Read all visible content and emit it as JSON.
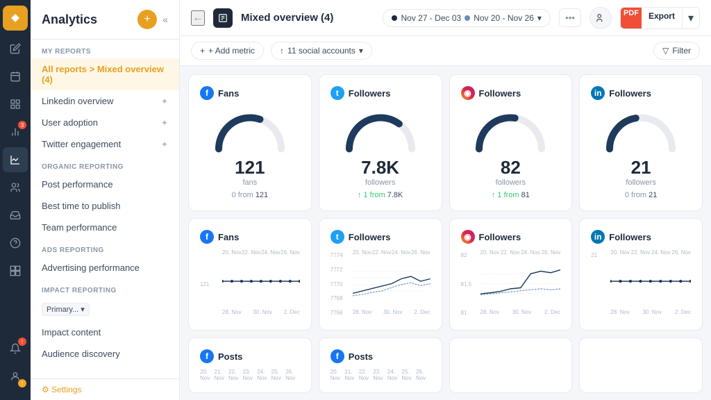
{
  "app": {
    "title": "Analytics",
    "collapse_label": "«"
  },
  "sidebar": {
    "section_my_reports": "MY REPORTS",
    "section_organic": "ORGANIC REPORTING",
    "section_ads": "ADS REPORTING",
    "section_impact": "IMPACT REPORTING",
    "active_item": "All reports > Mixed overview (4)",
    "items_my_reports": [
      {
        "id": "linkedin-overview",
        "label": "Linkedin overview"
      },
      {
        "id": "user-adoption",
        "label": "User adoption"
      },
      {
        "id": "twitter-engagement",
        "label": "Twitter engagement"
      }
    ],
    "items_organic": [
      {
        "id": "post-performance",
        "label": "Post performance"
      },
      {
        "id": "best-time",
        "label": "Best time to publish"
      },
      {
        "id": "team-performance",
        "label": "Team performance"
      }
    ],
    "items_ads": [
      {
        "id": "advertising-performance",
        "label": "Advertising performance"
      }
    ],
    "impact_badge": "Primary...",
    "items_impact": [
      {
        "id": "impact-content",
        "label": "Impact content"
      },
      {
        "id": "audience-discovery",
        "label": "Audience discovery"
      }
    ],
    "settings_label": "⚙ Settings"
  },
  "topbar": {
    "report_title": "Mixed overview (4)",
    "date_range_1": "Nov 27 - Dec 03",
    "date_range_2": "Nov 20 - Nov 26",
    "date_dot_1_color": "#1e2a3a",
    "date_dot_2_color": "#6b8cba",
    "export_badge": "PDF",
    "export_label": "Export"
  },
  "subbar": {
    "add_metric": "+ Add metric",
    "social_accounts": "↑ 11 social accounts",
    "filter": "Filter"
  },
  "cards_row1": [
    {
      "platform": "fb",
      "platform_label": "Fans",
      "value": "121",
      "unit": "fans",
      "change": "0 from ",
      "change_ref": "121",
      "change_up": false,
      "gauge_pct": 0.6
    },
    {
      "platform": "tw",
      "platform_label": "Followers",
      "value": "7.8K",
      "unit": "followers",
      "change": "↑ 1 from ",
      "change_ref": "7.8K",
      "change_up": true,
      "gauge_pct": 0.7
    },
    {
      "platform": "ig",
      "platform_label": "Followers",
      "value": "82",
      "unit": "followers",
      "change": "↑ 1 from ",
      "change_ref": "81",
      "change_up": true,
      "gauge_pct": 0.55
    },
    {
      "platform": "li",
      "platform_label": "Followers",
      "value": "21",
      "unit": "followers",
      "change": "0 from ",
      "change_ref": "21",
      "change_up": false,
      "gauge_pct": 0.45
    }
  ],
  "cards_row2": [
    {
      "platform": "fb",
      "platform_label": "Fans",
      "x_labels": [
        "20. Nov",
        "22. Nov",
        "24. Nov",
        "26. Nov"
      ],
      "x_labels2": [
        "28. Nov",
        "30. Nov",
        "2. Dec"
      ],
      "y_labels": [
        "",
        "121",
        ""
      ],
      "flat_value": 121
    },
    {
      "platform": "tw",
      "platform_label": "Followers",
      "x_labels": [
        "20. Nov",
        "22. Nov",
        "24. Nov",
        "26. Nov"
      ],
      "x_labels2": [
        "28. Nov",
        "30. Nov",
        "2. Dec"
      ],
      "y_labels": [
        "7774",
        "7772",
        "7770",
        "7768",
        "7766"
      ]
    },
    {
      "platform": "ig",
      "platform_label": "Followers",
      "x_labels": [
        "20. Nov",
        "22. Nov",
        "24. Nov",
        "26. Nov"
      ],
      "x_labels2": [
        "28. Nov",
        "30. Nov",
        "2. Dec"
      ],
      "y_labels": [
        "82",
        "81.5",
        "81"
      ]
    },
    {
      "platform": "li",
      "platform_label": "Followers",
      "x_labels": [
        "20. Nov",
        "22. Nov",
        "24. Nov",
        "26. Nov"
      ],
      "x_labels2": [
        "28. Nov",
        "30. Nov",
        "2. Dec"
      ],
      "y_labels": [
        "21",
        ""
      ]
    }
  ],
  "cards_row3": [
    {
      "platform": "fb",
      "platform_label": "Posts",
      "x_labels": [
        "20. Nov",
        "21. Nov",
        "22. Nov",
        "23. Nov",
        "24. Nov",
        "25. Nov",
        "26. Nov"
      ]
    },
    {
      "platform": "fb",
      "platform_label": "Posts",
      "x_labels": [
        "20. Nov",
        "21. Nov",
        "22. Nov",
        "23. Nov",
        "24. Nov",
        "25. Nov",
        "26. Nov"
      ]
    }
  ],
  "icons": {
    "back": "←",
    "collapse": "«",
    "pin": "✦",
    "chevron_down": "▾",
    "plus": "+",
    "filter": "⚡",
    "share": "👤",
    "more": "•••",
    "settings": "⚙"
  }
}
